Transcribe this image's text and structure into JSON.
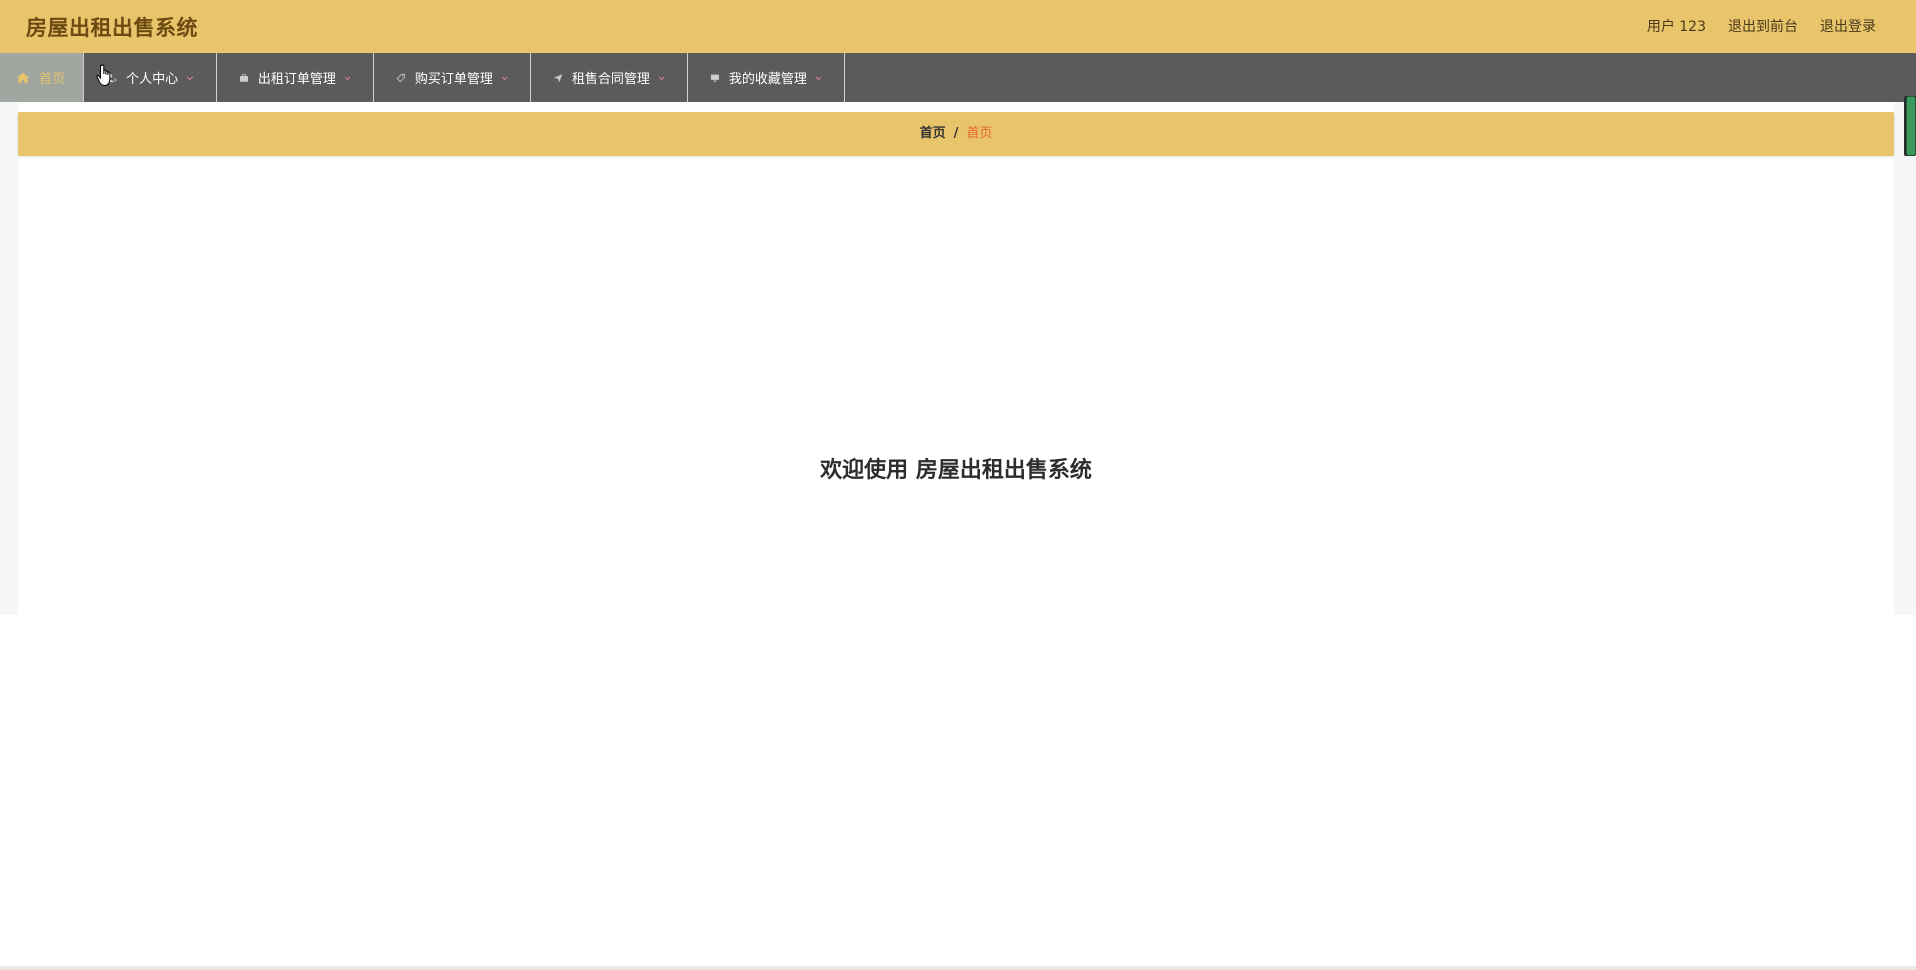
{
  "header": {
    "title": "房屋出租出售系统",
    "user_label": "用户 123",
    "front_link": "退出到前台",
    "logout_link": "退出登录"
  },
  "nav": {
    "items": [
      {
        "label": "首页",
        "icon": "home-icon"
      },
      {
        "label": "个人中心",
        "icon": "user-icon"
      },
      {
        "label": "出租订单管理",
        "icon": "briefcase-icon"
      },
      {
        "label": "购买订单管理",
        "icon": "tag-icon"
      },
      {
        "label": "租售合同管理",
        "icon": "send-icon"
      },
      {
        "label": "我的收藏管理",
        "icon": "monitor-icon"
      }
    ]
  },
  "breadcrumb": {
    "root": "首页",
    "separator": "/",
    "current": "首页"
  },
  "main": {
    "welcome_text": "欢迎使用 房屋出租出售系统"
  },
  "colors": {
    "header_bg": "#e8c46b",
    "nav_bg": "#5b5b5b",
    "active_bg": "#9fa7a0",
    "active_text": "#e7c46a",
    "crumb_current": "#e5652b"
  }
}
